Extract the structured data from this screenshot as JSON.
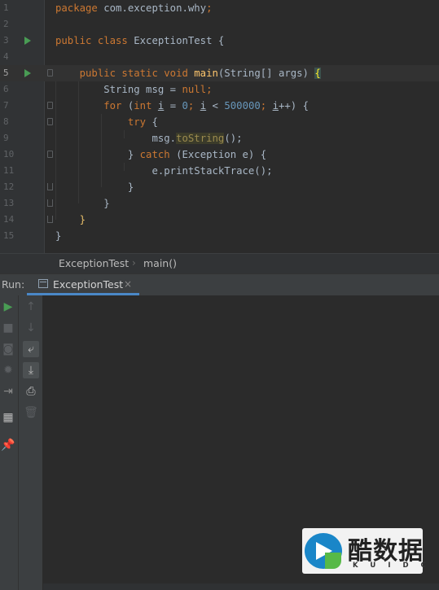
{
  "editor": {
    "lines": [
      {
        "num": "1",
        "tokens": [
          {
            "t": "package ",
            "c": "kw"
          },
          {
            "t": "com.exception.why",
            "c": ""
          },
          {
            "t": ";",
            "c": "kw"
          }
        ]
      },
      {
        "num": "2",
        "tokens": []
      },
      {
        "num": "3",
        "tokens": [
          {
            "t": "public class ",
            "c": "kw"
          },
          {
            "t": "ExceptionTest {",
            "c": ""
          }
        ],
        "run": true
      },
      {
        "num": "4",
        "tokens": []
      },
      {
        "num": "5",
        "tokens": [
          {
            "t": "    public static void ",
            "c": "kw"
          },
          {
            "t": "main",
            "c": "fn"
          },
          {
            "t": "(String[] args) ",
            "c": ""
          },
          {
            "t": "{",
            "c": "brace-hl"
          }
        ],
        "run": true,
        "current": true
      },
      {
        "num": "6",
        "tokens": [
          {
            "t": "        String msg = ",
            "c": ""
          },
          {
            "t": "null",
            "c": "kw"
          },
          {
            "t": ";",
            "c": "kw"
          }
        ]
      },
      {
        "num": "7",
        "tokens": [
          {
            "t": "        ",
            "c": ""
          },
          {
            "t": "for ",
            "c": "kw"
          },
          {
            "t": "(",
            "c": ""
          },
          {
            "t": "int ",
            "c": "kw"
          },
          {
            "t": "i",
            "c": "under"
          },
          {
            "t": " = ",
            "c": ""
          },
          {
            "t": "0",
            "c": "num"
          },
          {
            "t": "; ",
            "c": "kw"
          },
          {
            "t": "i",
            "c": "under"
          },
          {
            "t": " < ",
            "c": ""
          },
          {
            "t": "500000",
            "c": "num"
          },
          {
            "t": "; ",
            "c": "kw"
          },
          {
            "t": "i",
            "c": "under"
          },
          {
            "t": "++) {",
            "c": ""
          }
        ]
      },
      {
        "num": "8",
        "tokens": [
          {
            "t": "            ",
            "c": ""
          },
          {
            "t": "try ",
            "c": "kw"
          },
          {
            "t": "{",
            "c": ""
          }
        ]
      },
      {
        "num": "9",
        "tokens": [
          {
            "t": "                msg.",
            "c": ""
          },
          {
            "t": "toString",
            "c": "warn"
          },
          {
            "t": "();",
            "c": ""
          }
        ]
      },
      {
        "num": "10",
        "tokens": [
          {
            "t": "            } ",
            "c": ""
          },
          {
            "t": "catch ",
            "c": "kw"
          },
          {
            "t": "(Exception e) {",
            "c": ""
          }
        ]
      },
      {
        "num": "11",
        "tokens": [
          {
            "t": "                e.printStackTrace();",
            "c": ""
          }
        ]
      },
      {
        "num": "12",
        "tokens": [
          {
            "t": "            }",
            "c": ""
          }
        ]
      },
      {
        "num": "13",
        "tokens": [
          {
            "t": "        }",
            "c": ""
          }
        ]
      },
      {
        "num": "14",
        "tokens": [
          {
            "t": "    ",
            "c": ""
          },
          {
            "t": "}",
            "c": "brace-hl2"
          }
        ]
      },
      {
        "num": "15",
        "tokens": [
          {
            "t": "}",
            "c": ""
          }
        ]
      }
    ]
  },
  "breadcrumb": {
    "items": [
      "ExceptionTest",
      "main()"
    ],
    "separator": "›"
  },
  "run_panel": {
    "label": "Run:",
    "tab_label": "ExceptionTest",
    "tab_close": "×"
  },
  "toolbar_left": [
    {
      "icon": "run-icon",
      "glyph": "▶",
      "color": "#499c54"
    },
    {
      "icon": "stop-icon",
      "glyph": "■",
      "color": "#5a5d60"
    },
    {
      "icon": "camera-icon",
      "glyph": "◙",
      "color": "#5a5d60"
    },
    {
      "icon": "bug-settings-icon",
      "glyph": "✹",
      "color": "#5a5d60"
    },
    {
      "icon": "exit-icon",
      "glyph": "⇥",
      "color": "#8c8c8c"
    },
    {
      "icon": "layout-icon",
      "glyph": "▦",
      "color": "#bbbbbb"
    },
    {
      "icon": "pin-icon",
      "glyph": "📌",
      "color": "#bbbbbb"
    }
  ],
  "toolbar_right": [
    {
      "icon": "arrow-up-icon",
      "glyph": "↑",
      "color": "#5a5d60"
    },
    {
      "icon": "arrow-down-icon",
      "glyph": "↓",
      "color": "#5a5d60"
    },
    {
      "icon": "soft-wrap-icon",
      "glyph": "⤶",
      "color": "#bbbbbb",
      "active": true
    },
    {
      "icon": "scroll-to-end-icon",
      "glyph": "⤓",
      "color": "#bbbbbb",
      "active": true
    },
    {
      "icon": "print-icon",
      "glyph": "⎙",
      "color": "#bbbbbb"
    },
    {
      "icon": "trash-icon",
      "glyph": "🗑",
      "color": "#5a5d60"
    }
  ],
  "watermark": {
    "text_cn": "酷数据",
    "text_en": "KUIDC"
  },
  "colors": {
    "background": "#2b2b2b",
    "keyword": "#cc7832",
    "number": "#6897bb",
    "method": "#ffc66d",
    "text": "#a9b7c6",
    "run_green": "#499c54",
    "tab_underline": "#4a88c7"
  }
}
